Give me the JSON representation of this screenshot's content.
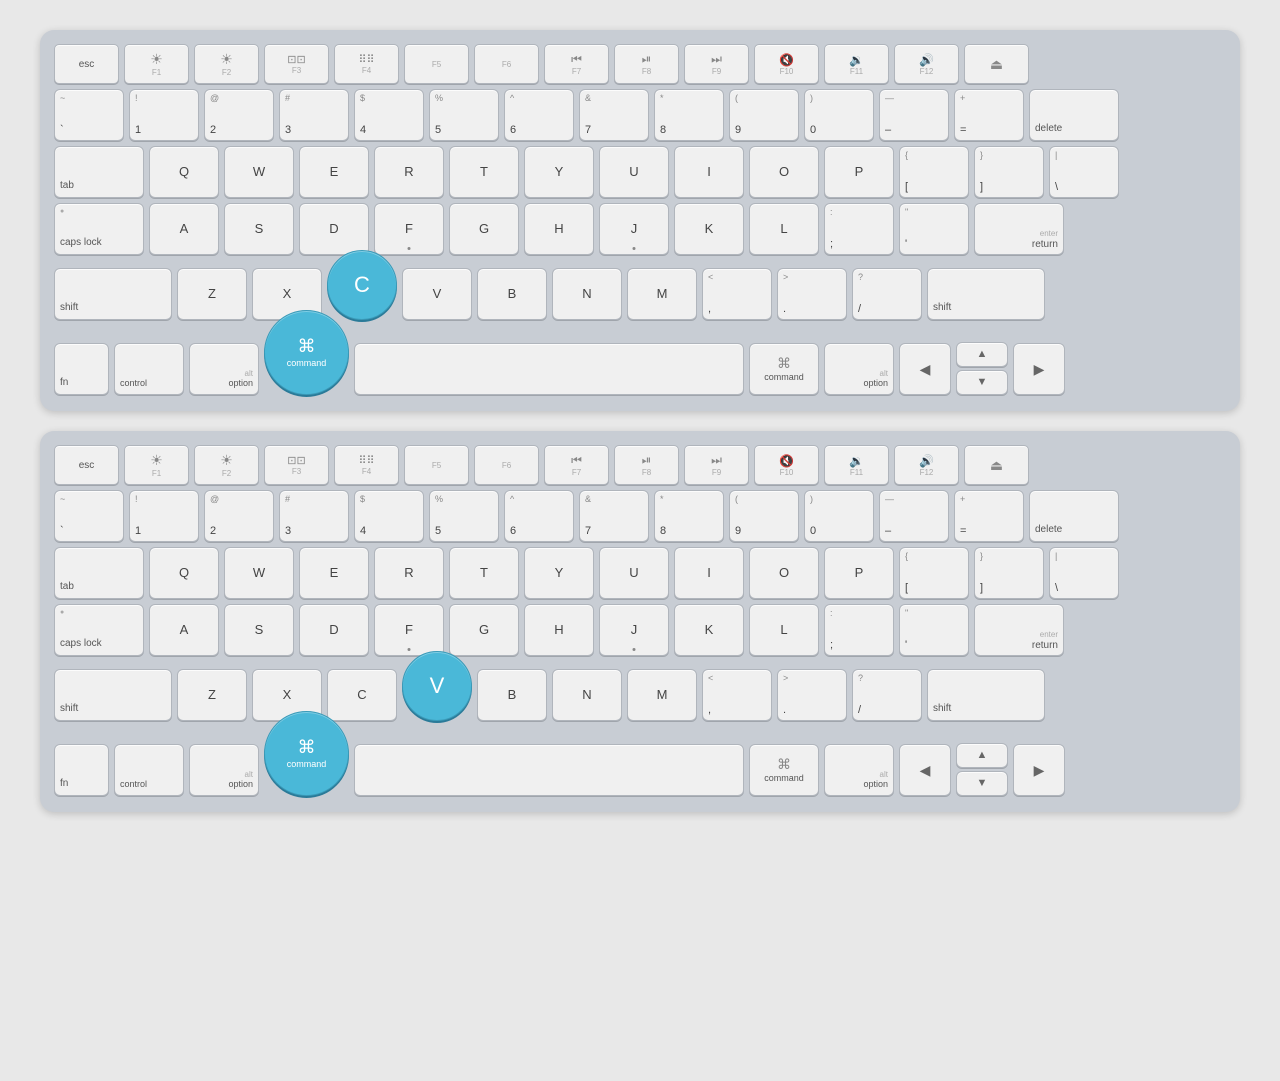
{
  "keyboards": [
    {
      "id": "keyboard-1",
      "highlighted_keys": [
        "C",
        "command-left"
      ]
    },
    {
      "id": "keyboard-2",
      "highlighted_keys": [
        "V",
        "command-left"
      ]
    }
  ],
  "labels": {
    "esc": "esc",
    "tab": "tab",
    "caps_lock": "caps lock",
    "shift": "shift",
    "fn": "fn",
    "control": "control",
    "option": "option",
    "command": "command",
    "delete": "delete",
    "return": "return",
    "enter": "enter",
    "space": ""
  }
}
